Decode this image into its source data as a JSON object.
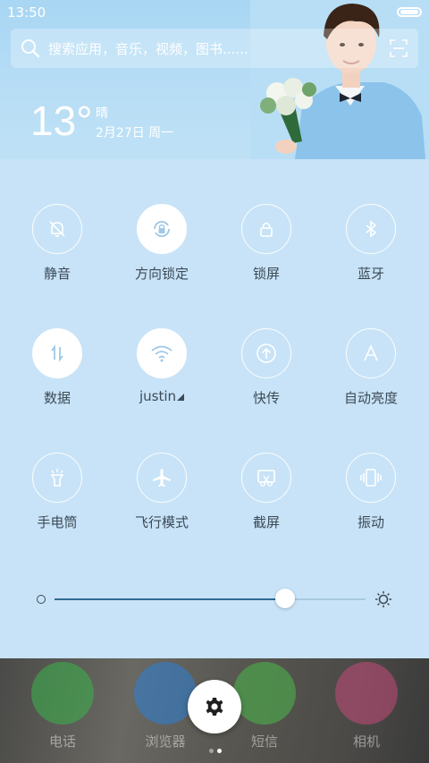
{
  "status_bar": {
    "time": "13:50"
  },
  "search": {
    "placeholder": "搜索应用，音乐，视频，图书......"
  },
  "weather": {
    "temperature": "13°",
    "condition": "晴",
    "date": "2月27日 周一"
  },
  "toggles": [
    {
      "label": "静音",
      "icon": "bell-off-icon",
      "on": false
    },
    {
      "label": "方向锁定",
      "icon": "rotation-lock-icon",
      "on": true
    },
    {
      "label": "锁屏",
      "icon": "lock-icon",
      "on": false
    },
    {
      "label": "蓝牙",
      "icon": "bluetooth-icon",
      "on": false
    },
    {
      "label": "数据",
      "icon": "mobile-data-icon",
      "on": true
    },
    {
      "label": "justin",
      "icon": "wifi-icon",
      "on": true
    },
    {
      "label": "快传",
      "icon": "fast-transfer-icon",
      "on": false
    },
    {
      "label": "自动亮度",
      "icon": "auto-brightness-icon",
      "on": false
    },
    {
      "label": "手电筒",
      "icon": "flashlight-icon",
      "on": false
    },
    {
      "label": "飞行模式",
      "icon": "airplane-icon",
      "on": false
    },
    {
      "label": "截屏",
      "icon": "screenshot-icon",
      "on": false
    },
    {
      "label": "振动",
      "icon": "vibrate-icon",
      "on": false
    }
  ],
  "brightness": {
    "value": 0.74
  },
  "dock": {
    "apps": [
      {
        "name": "电话",
        "icon": "phone-icon",
        "color": "#3bb54a"
      },
      {
        "name": "浏览器",
        "icon": "compass-icon",
        "color": "#2b7fd6"
      },
      {
        "name": "短信",
        "icon": "message-icon",
        "color": "#49b94a"
      },
      {
        "name": "相机",
        "icon": "camera-icon",
        "color": "#c44a78"
      }
    ]
  },
  "pager": {
    "current": 2,
    "total": 2
  },
  "colors": {
    "accent": "#2f6b93",
    "panel": "#c8e3f7",
    "label": "#3c4a57"
  }
}
